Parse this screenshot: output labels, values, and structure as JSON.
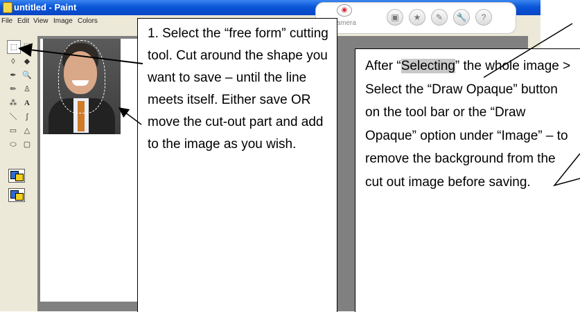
{
  "window": {
    "title": "untitled - Paint",
    "menu": [
      "File",
      "Edit",
      "View",
      "Image",
      "Colors"
    ]
  },
  "top_toolbar": {
    "webcam_label": "b Camera",
    "buttons": [
      {
        "name": "photo-icon",
        "glyph": "▣"
      },
      {
        "name": "star-icon",
        "glyph": "★"
      },
      {
        "name": "edit-icon",
        "glyph": "✎"
      },
      {
        "name": "wrench-icon",
        "glyph": "🔧"
      },
      {
        "name": "help-icon",
        "glyph": "?"
      }
    ]
  },
  "tools": [
    {
      "name": "free-form-select-tool-icon",
      "glyph": "⬚"
    },
    {
      "name": "select-tool-icon",
      "glyph": "⬚"
    },
    {
      "name": "eraser-tool-icon",
      "glyph": "◊"
    },
    {
      "name": "fill-tool-icon",
      "glyph": "◆"
    },
    {
      "name": "pick-color-tool-icon",
      "glyph": "✒"
    },
    {
      "name": "magnifier-tool-icon",
      "glyph": "🔍"
    },
    {
      "name": "pencil-tool-icon",
      "glyph": "✏"
    },
    {
      "name": "brush-tool-icon",
      "glyph": "♙"
    },
    {
      "name": "airbrush-tool-icon",
      "glyph": "⁂"
    },
    {
      "name": "text-tool-icon",
      "glyph": "A"
    },
    {
      "name": "line-tool-icon",
      "glyph": "＼"
    },
    {
      "name": "curve-tool-icon",
      "glyph": "∫"
    },
    {
      "name": "rectangle-tool-icon",
      "glyph": "▭"
    },
    {
      "name": "polygon-tool-icon",
      "glyph": "△"
    },
    {
      "name": "ellipse-tool-icon",
      "glyph": "⬭"
    },
    {
      "name": "rounded-rect-tool-icon",
      "glyph": "▢"
    }
  ],
  "callout_1": {
    "text": "1. Select the “free form” cutting tool. Cut around the shape you want to save – until the line meets itself. Either save OR  move the cut-out part and add to the image as you wish."
  },
  "callout_2": {
    "before": "After “",
    "highlight": "Selecting",
    "after": "” the whole image > Select the “Draw Opaque” button on the tool bar or the “Draw Opaque” option under “Image” – to remove the background from the cut out image before saving."
  },
  "colors": {
    "title_bar": "#0a55d8",
    "window_bg": "#ece9d8",
    "canvas_bg": "#808080"
  }
}
